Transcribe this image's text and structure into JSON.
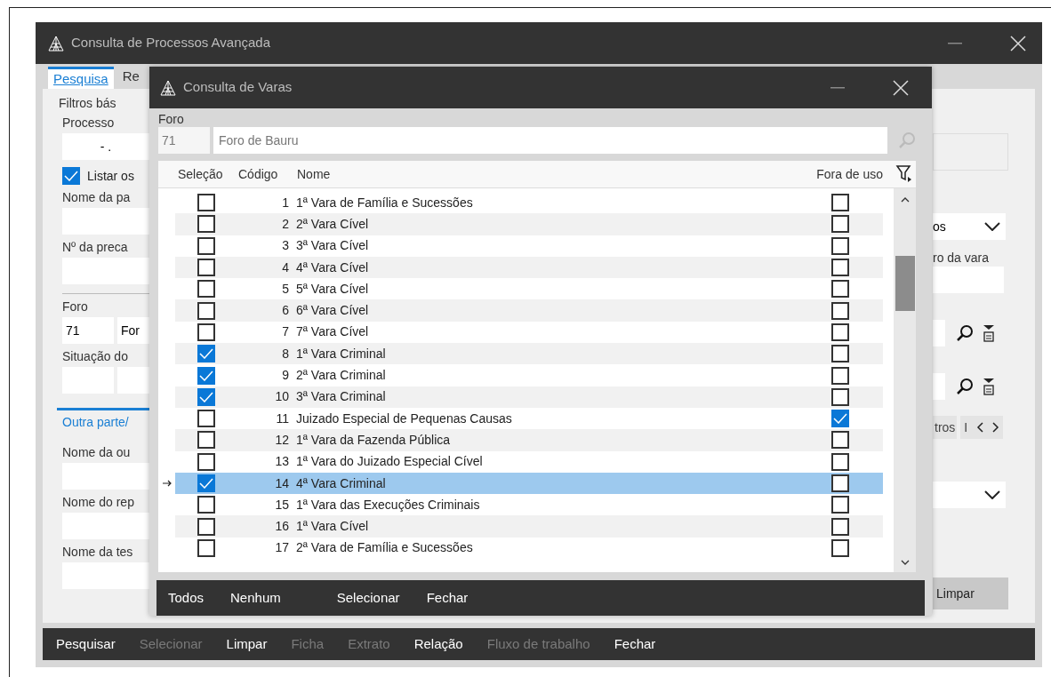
{
  "main_window": {
    "title": "Consulta de Processos Avançada",
    "tabs": [
      {
        "label": "Pesquisa",
        "selected": true
      },
      {
        "label": "Re",
        "selected": false
      }
    ],
    "left_column": [
      {
        "kind": "group_title",
        "text": "Filtros bás"
      },
      {
        "kind": "label",
        "text": "Processo"
      },
      {
        "kind": "field",
        "value": "- ."
      },
      {
        "kind": "checkbox",
        "label": "Listar os",
        "checked": true
      },
      {
        "kind": "label",
        "text": "Nome da pa"
      },
      {
        "kind": "field"
      },
      {
        "kind": "label",
        "text": "Nº da preca"
      },
      {
        "kind": "field"
      },
      {
        "kind": "divider"
      },
      {
        "kind": "label",
        "text": "Foro"
      },
      {
        "kind": "field_pair",
        "values": [
          "71",
          "For"
        ]
      },
      {
        "kind": "label",
        "text": "Situação do"
      },
      {
        "kind": "field_pair"
      },
      {
        "kind": "tab",
        "text": "Outra parte/"
      },
      {
        "kind": "label",
        "text": "Nome da ou"
      },
      {
        "kind": "field"
      },
      {
        "kind": "label",
        "text": "Nome do rep"
      },
      {
        "kind": "field"
      },
      {
        "kind": "label",
        "text": "Nome da tes"
      },
      {
        "kind": "field"
      }
    ],
    "right_column": [
      {
        "kind": "box"
      },
      {
        "kind": "combo",
        "value": "os"
      },
      {
        "kind": "label",
        "text": "ro da vara"
      },
      {
        "kind": "field"
      },
      {
        "kind": "lookup"
      },
      {
        "kind": "lookup"
      },
      {
        "kind": "tabstrip",
        "labels": [
          "tros",
          "I"
        ]
      },
      {
        "kind": "combo"
      },
      {
        "kind": "button",
        "text": "Limpar"
      }
    ],
    "toolbar": [
      {
        "label": "Pesquisar",
        "disabled": false
      },
      {
        "label": "Selecionar",
        "disabled": true
      },
      {
        "label": "Limpar",
        "disabled": false
      },
      {
        "label": "Ficha",
        "disabled": true
      },
      {
        "label": "Extrato",
        "disabled": true
      },
      {
        "label": "Relação",
        "disabled": false
      },
      {
        "label": "Fluxo de trabalho",
        "disabled": true
      },
      {
        "label": "Fechar",
        "disabled": false
      }
    ]
  },
  "dialog": {
    "title": "Consulta de Varas",
    "foro": {
      "label": "Foro",
      "code": "71",
      "name": "Foro de Bauru"
    },
    "columns": [
      "Seleção",
      "Código",
      "Nome",
      "Fora de uso"
    ],
    "rows": [
      {
        "code": "1",
        "name": "1ª Vara de Família e Sucessões",
        "checked": false,
        "out_of_use": false,
        "selected": false
      },
      {
        "code": "2",
        "name": "2ª Vara Cível",
        "checked": false,
        "out_of_use": false,
        "selected": false
      },
      {
        "code": "3",
        "name": "3ª Vara Cível",
        "checked": false,
        "out_of_use": false,
        "selected": false
      },
      {
        "code": "4",
        "name": "4ª Vara Cível",
        "checked": false,
        "out_of_use": false,
        "selected": false
      },
      {
        "code": "5",
        "name": "5ª Vara Cível",
        "checked": false,
        "out_of_use": false,
        "selected": false
      },
      {
        "code": "6",
        "name": "6ª Vara Cível",
        "checked": false,
        "out_of_use": false,
        "selected": false
      },
      {
        "code": "7",
        "name": "7ª Vara Cível",
        "checked": false,
        "out_of_use": false,
        "selected": false
      },
      {
        "code": "8",
        "name": "1ª Vara Criminal",
        "checked": true,
        "out_of_use": false,
        "selected": false
      },
      {
        "code": "9",
        "name": "2ª Vara Criminal",
        "checked": true,
        "out_of_use": false,
        "selected": false
      },
      {
        "code": "10",
        "name": "3ª Vara Criminal",
        "checked": true,
        "out_of_use": false,
        "selected": false
      },
      {
        "code": "11",
        "name": "Juizado Especial de Pequenas Causas",
        "checked": false,
        "out_of_use": true,
        "selected": false
      },
      {
        "code": "12",
        "name": "1ª Vara da Fazenda Pública",
        "checked": false,
        "out_of_use": false,
        "selected": false
      },
      {
        "code": "13",
        "name": "1ª Vara do Juizado Especial Cível",
        "checked": false,
        "out_of_use": false,
        "selected": false
      },
      {
        "code": "14",
        "name": "4ª Vara Criminal",
        "checked": true,
        "out_of_use": false,
        "selected": true
      },
      {
        "code": "15",
        "name": "1ª Vara das Execuções Criminais",
        "checked": false,
        "out_of_use": false,
        "selected": false
      },
      {
        "code": "16",
        "name": "1ª Vara Cível",
        "checked": false,
        "out_of_use": false,
        "selected": false
      },
      {
        "code": "17",
        "name": "2ª Vara de Família e Sucessões",
        "checked": false,
        "out_of_use": false,
        "selected": false
      }
    ],
    "selection_buttons": [
      "Todos",
      "Nenhum"
    ],
    "action_buttons": [
      "Selecionar",
      "Fechar"
    ]
  }
}
